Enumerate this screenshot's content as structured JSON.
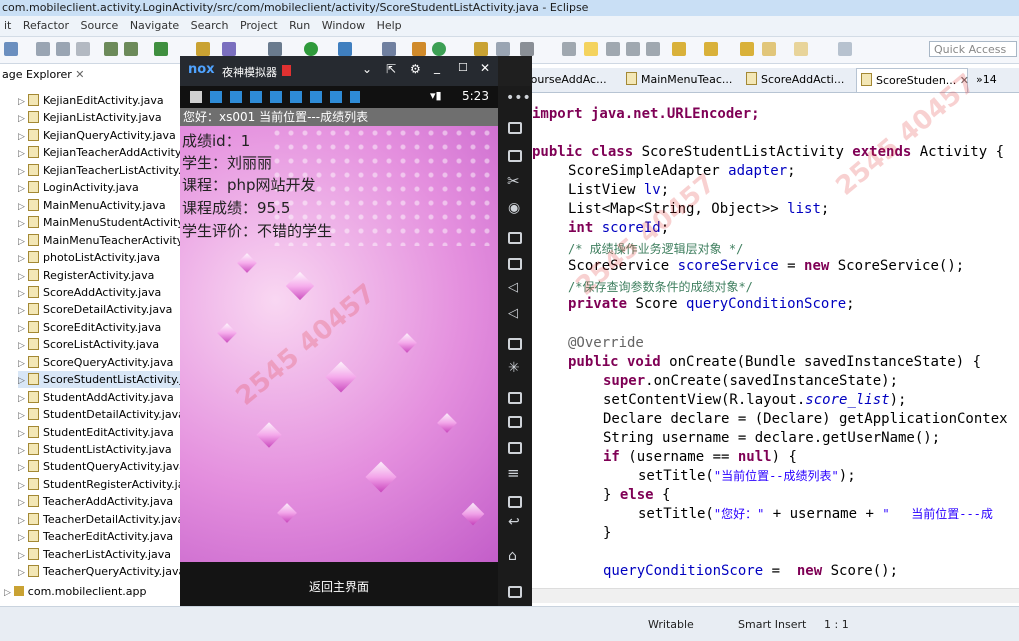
{
  "window": {
    "title": "com.mobileclient.activity.LoginActivity/src/com/mobileclient/activity/ScoreStudentListActivity.java - Eclipse"
  },
  "menu": [
    "it",
    "Refactor",
    "Source",
    "Navigate",
    "Search",
    "Project",
    "Run",
    "Window",
    "Help"
  ],
  "toolbar": {
    "quick_access": "Quick Access"
  },
  "package_explorer": {
    "title": "age Explorer",
    "items": [
      "KejianEditActivity.java",
      "KejianListActivity.java",
      "KejianQueryActivity.java",
      "KejianTeacherAddActivity.j",
      "KejianTeacherListActivity.ja",
      "LoginActivity.java",
      "MainMenuActivity.java",
      "MainMenuStudentActivity.",
      "MainMenuTeacherActivity.",
      "photoListActivity.java",
      "RegisterActivity.java",
      "ScoreAddActivity.java",
      "ScoreDetailActivity.java",
      "ScoreEditActivity.java",
      "ScoreListActivity.java",
      "ScoreQueryActivity.java",
      "ScoreStudentListActivity.ja",
      "StudentAddActivity.java",
      "StudentDetailActivity.java",
      "StudentEditActivity.java",
      "StudentListActivity.java",
      "StudentQueryActivity.java",
      "StudentRegisterActivity.jav",
      "TeacherAddActivity.java",
      "TeacherDetailActivity.java",
      "TeacherEditActivity.java",
      "TeacherListActivity.java",
      "TeacherQueryActivity.java"
    ],
    "package": "com.mobileclient.app"
  },
  "emulator": {
    "title": "夜神模拟器",
    "time": "5:23",
    "app_title": "您好：xs001   当前位置---成绩列表",
    "record": {
      "id": "成绩id：1",
      "student": "学生：刘丽丽",
      "course": "课程：php网站开发",
      "score": "课程成绩：95.5",
      "comment": "学生评价：不错的学生"
    },
    "back_button": "返回主界面"
  },
  "editor": {
    "tabs": [
      "CourseAddAc...",
      "MainMenuTeac...",
      "ScoreAddActi...",
      "ScoreStuden...",
      "»14"
    ],
    "code": {
      "l1": "import java.net.URLEncoder;",
      "l2a": "public class ",
      "l2b": "ScoreStudentListActivity ",
      "l2c": "extends ",
      "l2d": "Activity {",
      "l3a": "ScoreSimpleAdapter ",
      "l3b": "adapter",
      "l4a": "ListView ",
      "l4b": "lv",
      "l5a": "List<Map<String, Object>> ",
      "l5b": "list",
      "l6a": "int ",
      "l6b": "scoreId",
      "l7": "/* 成绩操作业务逻辑层对象 */",
      "l8a": "ScoreService ",
      "l8b": "scoreService",
      "l8c": " = ",
      "l8d": "new ",
      "l8e": "ScoreService();",
      "l9": "/*保存查询参数条件的成绩对象*/",
      "l10a": "private ",
      "l10b": "Score ",
      "l10c": "queryConditionScore",
      "l11": "@Override",
      "l12a": "public void ",
      "l12b": "onCreate(Bundle savedInstanceState) {",
      "l13a": "super",
      "l13b": ".onCreate(savedInstanceState);",
      "l14a": "setContentView(R.layout.",
      "l14b": "score_list",
      "l14c": ");",
      "l15": "Declare declare = (Declare) getApplicationContex",
      "l16": "String username = declare.getUserName();",
      "l17a": "if ",
      "l17b": "(username == ",
      "l17c": "null",
      "l17d": ") {",
      "l18a": "setTitle(",
      "l18b": "\"当前位置--成绩列表\"",
      "l18c": ");",
      "l19a": "} ",
      "l19b": "else ",
      "l19c": "{",
      "l20a": "setTitle(",
      "l20b": "\"您好：\"",
      "l20c": " + username + ",
      "l20d": "\"   当前位置---成",
      "l21": "}",
      "l22a": "queryConditionScore",
      "l22b": " =  ",
      "l22c": "new ",
      "l22d": "Score();"
    }
  },
  "status": {
    "writable": "Writable",
    "insert_mode": "Smart Insert",
    "position": "1 : 1"
  }
}
